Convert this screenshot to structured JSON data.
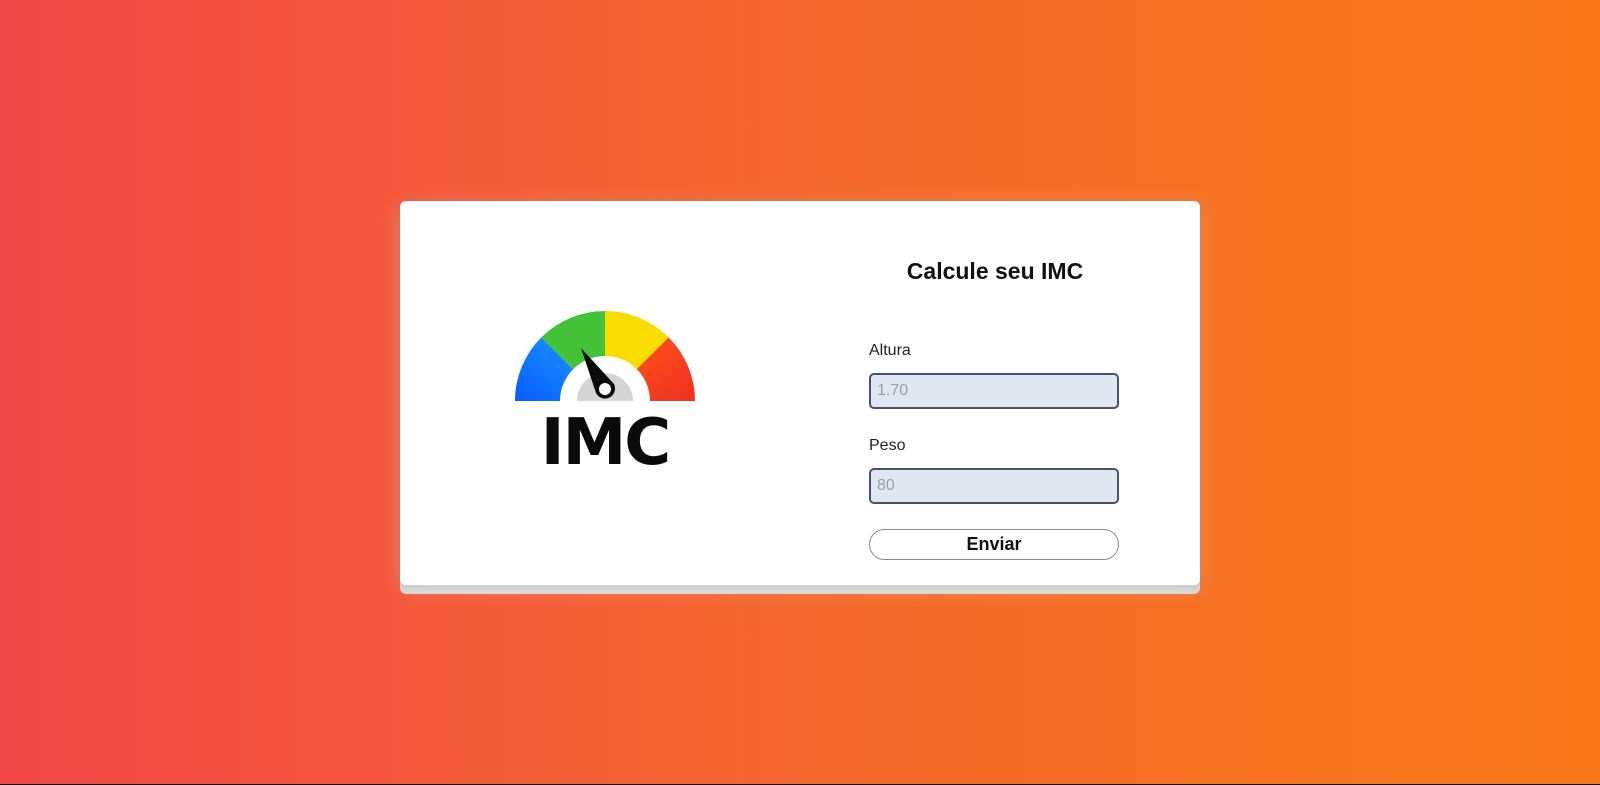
{
  "page": {
    "background_start": "#f24848",
    "background_end": "#f97718"
  },
  "logo": {
    "text": "IMC",
    "gauge_colors": [
      "#0a6bff",
      "#43c238",
      "#f9dd00",
      "#fc3f1f"
    ],
    "icon": "gauge-icon"
  },
  "form": {
    "title": "Calcule seu IMC",
    "altura": {
      "label": "Altura",
      "value": "",
      "placeholder": "1.70"
    },
    "peso": {
      "label": "Peso",
      "value": "",
      "placeholder": "80"
    },
    "submit_label": "Enviar"
  }
}
